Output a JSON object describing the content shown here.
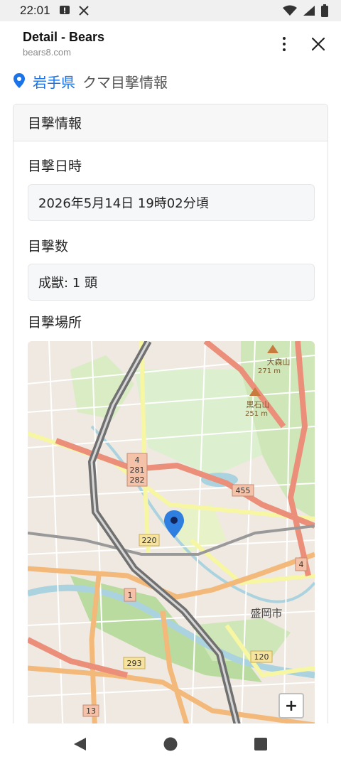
{
  "status_bar": {
    "time": "22:01",
    "icons": [
      "notification-icon",
      "x-app-icon",
      "wifi-icon",
      "signal-icon",
      "battery-icon"
    ]
  },
  "tab": {
    "title": "Detail - Bears",
    "url": "bears8.com"
  },
  "heading": {
    "prefecture": "岩手県",
    "title": "クマ目撃情報",
    "accent_color": "#1a73e8"
  },
  "card": {
    "header": "目撃情報",
    "datetime_label": "目撃日時",
    "datetime_value": "2026年5月14日 19時02分頃",
    "count_label": "目撃数",
    "count_value": "成獣: 1 頭",
    "location_label": "目撃場所"
  },
  "map": {
    "labels": {
      "mountain1": "大森山",
      "mountain1_elev": "271 m",
      "mountain2": "黒石山",
      "mountain2_elev": "251 m",
      "city": "盛岡市",
      "route_4a": "4",
      "route_281": "281",
      "route_282": "282",
      "route_455": "455",
      "route_220": "220",
      "route_4b": "4",
      "route_1": "1",
      "route_120": "120",
      "route_293": "293",
      "route_13": "13"
    },
    "zoom_in_label": "+"
  },
  "nav": {
    "buttons": [
      "back",
      "home",
      "recents"
    ]
  }
}
